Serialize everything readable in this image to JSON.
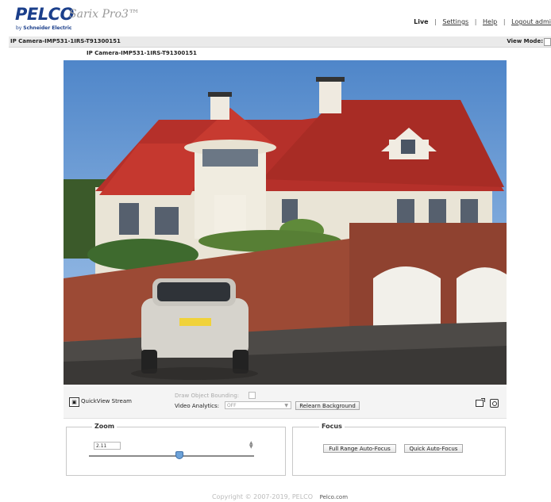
{
  "header": {
    "brand": "PELCO",
    "brand_sub_prefix": "by",
    "brand_sub": "Schneider Electric",
    "product": "Sarix Pro3™",
    "nav": {
      "live": "Live",
      "settings": "Settings",
      "help": "Help",
      "logout": "Logout admi"
    }
  },
  "camera_bar": {
    "title": "IP Camera-IMP531-1IRS-T91300151",
    "view_mode_label": "View Mode:"
  },
  "stream_title": "IP Camera-IMP531-1IRS-T91300151",
  "controls": {
    "quickview_label": "QuickView Stream",
    "draw_bounding_label": "Draw Object Bounding:",
    "analytics_label": "Video Analytics:",
    "analytics_value": "OFF",
    "relearn_label": "Relearn Background"
  },
  "zoom": {
    "legend": "Zoom",
    "value": "2.11",
    "slider_fraction": 0.55
  },
  "focus": {
    "legend": "Focus",
    "full_range_label": "Full Range Auto-Focus",
    "quick_label": "Quick Auto-Focus"
  },
  "footer": {
    "copyright": "Copyright © 2007-2019, PELCO",
    "site": "Pelco.com"
  },
  "icons": {
    "quickview": "quickview-icon",
    "snapshot": "snapshot-icon",
    "camera": "camera-icon"
  }
}
